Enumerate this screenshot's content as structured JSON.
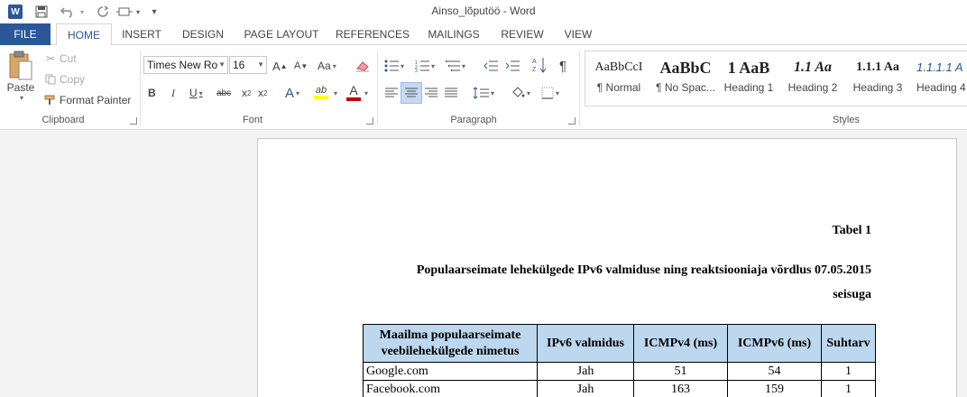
{
  "window": {
    "title": "Ainso_lõputöö - Word"
  },
  "quick_access": {
    "app_icon": "W"
  },
  "tabs": [
    "FILE",
    "HOME",
    "INSERT",
    "DESIGN",
    "PAGE LAYOUT",
    "REFERENCES",
    "MAILINGS",
    "REVIEW",
    "VIEW"
  ],
  "clipboard": {
    "paste": "Paste",
    "cut": "Cut",
    "copy": "Copy",
    "format_painter": "Format Painter",
    "group": "Clipboard"
  },
  "font": {
    "family": "Times New Ro",
    "size": "16",
    "bold": "B",
    "italic": "I",
    "underline": "U",
    "strike": "abc",
    "sub": "x",
    "sub_mark": "2",
    "sup": "x",
    "sup_mark": "2",
    "grow": "A",
    "shrink": "A",
    "case": "Aa",
    "group": "Font"
  },
  "paragraph": {
    "group": "Paragraph",
    "pilcrow": "¶"
  },
  "styles": {
    "group": "Styles",
    "items": [
      {
        "preview": "AaBbCcI",
        "name": "¶ Normal"
      },
      {
        "preview": "AaBbC",
        "name": "¶ No Spac..."
      },
      {
        "preview": "1 AaB",
        "name": "Heading 1"
      },
      {
        "preview": "1.1 Aa",
        "name": "Heading 2"
      },
      {
        "preview": "1.1.1 Aa",
        "name": "Heading 3"
      },
      {
        "preview": "1.1.1.1 A",
        "name": "Heading 4"
      }
    ]
  },
  "document": {
    "table_label": "Tabel 1",
    "heading_line1": "Populaarseimate lehekülgede IPv6 valmiduse ning reaktsiooniaja võrdlus 07.05.2015",
    "heading_line2": "seisuga",
    "table": {
      "headers": [
        "Maailma populaarseimate veebilehekülgede nimetus",
        "IPv6 valmidus",
        "ICMPv4 (ms)",
        "ICMPv6 (ms)",
        "Suhtarv"
      ],
      "rows": [
        [
          "Google.com",
          "Jah",
          "51",
          "54",
          "1"
        ],
        [
          "Facebook.com",
          "Jah",
          "163",
          "159",
          "1"
        ]
      ]
    }
  },
  "colors": {
    "accent": "#2b579a",
    "table_header": "#bdd7ee",
    "highlight": "#ffff00",
    "font_color": "#c00000"
  }
}
